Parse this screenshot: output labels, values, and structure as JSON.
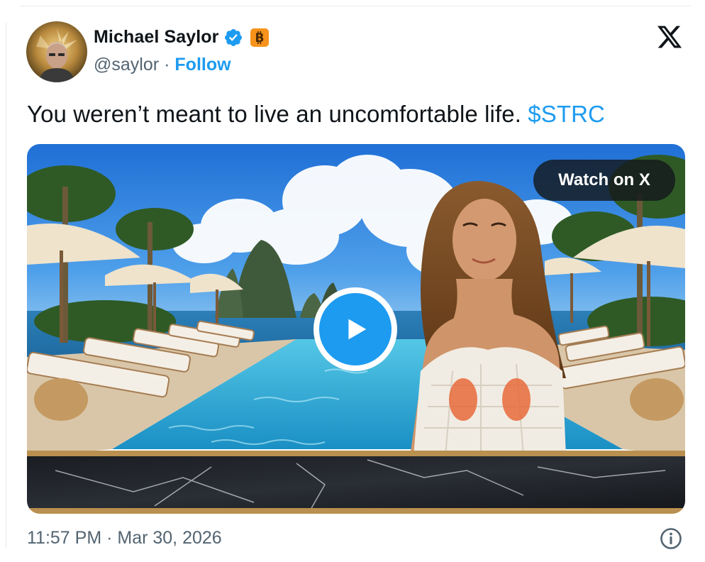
{
  "author": {
    "name": "Michael Saylor",
    "handle": "@saylor",
    "separator": "·",
    "follow_label": "Follow",
    "badges": [
      "verified-badge-icon",
      "bitcoin-badge-icon"
    ]
  },
  "tweet": {
    "text": "You weren’t meant to live an uncomfortable life.",
    "cashtag": "$STRC"
  },
  "media": {
    "watch_label": "Watch on X",
    "play_icon": "play-icon"
  },
  "footer": {
    "timestamp": "11:57 PM · Mar 30, 2026",
    "info_icon": "info-icon"
  },
  "brand": {
    "logo_icon": "x-logo-icon",
    "accent_color": "#1d9bf0",
    "bitcoin_color": "#f7931a"
  }
}
